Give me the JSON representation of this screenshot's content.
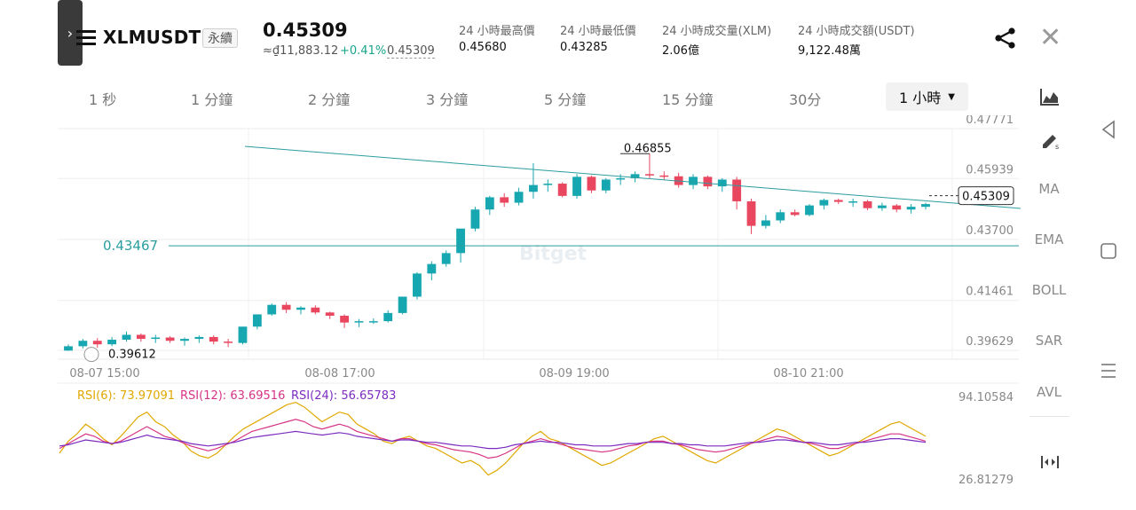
{
  "header": {
    "symbol": "XLMUSDT",
    "contract_type": "永續",
    "last_price": "0.45309",
    "fiat_price": "≈₫11,883.12",
    "change_pct": "+0.41%",
    "mark_price": "0.45309",
    "stats": [
      {
        "label": "24 小時最高價",
        "value": "0.45680"
      },
      {
        "label": "24 小時最低價",
        "value": "0.43285"
      },
      {
        "label": "24 小時成交量(XLM)",
        "value": "2.06億"
      },
      {
        "label": "24 小時成交額(USDT)",
        "value": "9,122.48萬"
      }
    ]
  },
  "timeframes": [
    "1 秒",
    "1 分鐘",
    "2 分鐘",
    "3 分鐘",
    "5 分鐘",
    "15 分鐘",
    "30分"
  ],
  "active_timeframe": "1 小時",
  "tools": [
    "MA",
    "EMA",
    "BOLL",
    "SAR",
    "AVL"
  ],
  "colors": {
    "up": "#17a7b0",
    "down": "#e8475f",
    "accent": "#2a9d9f",
    "rsi6": "#e0a800",
    "rsi12": "#d63384",
    "rsi24": "#7b2cbf"
  },
  "chart_data": [
    {
      "type": "candlestick",
      "price_axis_ticks": [
        "0.47771",
        "0.45939",
        "0.43700",
        "0.41461",
        "0.39629"
      ],
      "time_axis_ticks": [
        "08-07 15:00",
        "08-08 17:00",
        "08-09 19:00",
        "08-10 21:00"
      ],
      "high_label": "0.46855",
      "low_label": "0.39612",
      "horizontal_line_label": "0.43467",
      "current_price_label": "0.45309",
      "watermark": "Bitget",
      "ylim": [
        0.39629,
        0.47771
      ],
      "ohlc": [
        [
          0.3962,
          0.3985,
          0.3961,
          0.3978
        ],
        [
          0.3978,
          0.4005,
          0.397,
          0.3998
        ],
        [
          0.3998,
          0.4008,
          0.3972,
          0.3985
        ],
        [
          0.3985,
          0.4012,
          0.3978,
          0.4002
        ],
        [
          0.4002,
          0.4032,
          0.3995,
          0.402
        ],
        [
          0.402,
          0.4025,
          0.3995,
          0.4005
        ],
        [
          0.4005,
          0.402,
          0.399,
          0.401
        ],
        [
          0.401,
          0.4015,
          0.399,
          0.3998
        ],
        [
          0.3998,
          0.401,
          0.398,
          0.4005
        ],
        [
          0.4005,
          0.4018,
          0.399,
          0.4012
        ],
        [
          0.4012,
          0.4018,
          0.3985,
          0.3995
        ],
        [
          0.3995,
          0.4005,
          0.3975,
          0.399
        ],
        [
          0.399,
          0.404,
          0.3985,
          0.405
        ],
        [
          0.405,
          0.4095,
          0.404,
          0.4095
        ],
        [
          0.4095,
          0.4135,
          0.409,
          0.413
        ],
        [
          0.413,
          0.414,
          0.41,
          0.4112
        ],
        [
          0.4112,
          0.4125,
          0.4095,
          0.412
        ],
        [
          0.412,
          0.4128,
          0.4095,
          0.4102
        ],
        [
          0.4102,
          0.4105,
          0.4078,
          0.409
        ],
        [
          0.409,
          0.4095,
          0.4045,
          0.4065
        ],
        [
          0.4065,
          0.4078,
          0.4048,
          0.407
        ],
        [
          0.407,
          0.408,
          0.406,
          0.407
        ],
        [
          0.407,
          0.411,
          0.4065,
          0.41
        ],
        [
          0.41,
          0.416,
          0.4095,
          0.416
        ],
        [
          0.416,
          0.425,
          0.415,
          0.4245
        ],
        [
          0.4245,
          0.429,
          0.422,
          0.428
        ],
        [
          0.428,
          0.433,
          0.427,
          0.432
        ],
        [
          0.432,
          0.436,
          0.4285,
          0.441
        ],
        [
          0.441,
          0.449,
          0.44,
          0.448
        ],
        [
          0.448,
          0.453,
          0.446,
          0.4525
        ],
        [
          0.4525,
          0.454,
          0.449,
          0.4505
        ],
        [
          0.4505,
          0.456,
          0.4495,
          0.4545
        ],
        [
          0.4545,
          0.465,
          0.452,
          0.457
        ],
        [
          0.457,
          0.459,
          0.4545,
          0.4575
        ],
        [
          0.4575,
          0.458,
          0.4525,
          0.453
        ],
        [
          0.453,
          0.461,
          0.452,
          0.46
        ],
        [
          0.46,
          0.4605,
          0.454,
          0.455
        ],
        [
          0.455,
          0.4595,
          0.454,
          0.459
        ],
        [
          0.459,
          0.461,
          0.457,
          0.4595
        ],
        [
          0.4595,
          0.462,
          0.458,
          0.461
        ],
        [
          0.461,
          0.4685,
          0.4595,
          0.4605
        ],
        [
          0.4605,
          0.462,
          0.459,
          0.4602
        ],
        [
          0.4602,
          0.4615,
          0.456,
          0.457
        ],
        [
          0.457,
          0.461,
          0.4555,
          0.46
        ],
        [
          0.46,
          0.4605,
          0.4555,
          0.4565
        ],
        [
          0.4565,
          0.4595,
          0.4545,
          0.459
        ],
        [
          0.459,
          0.46,
          0.448,
          0.451
        ],
        [
          0.451,
          0.452,
          0.439,
          0.442
        ],
        [
          0.442,
          0.446,
          0.441,
          0.444
        ],
        [
          0.444,
          0.448,
          0.443,
          0.447
        ],
        [
          0.447,
          0.448,
          0.4455,
          0.446
        ],
        [
          0.446,
          0.45,
          0.4455,
          0.4495
        ],
        [
          0.4495,
          0.452,
          0.448,
          0.4515
        ],
        [
          0.4515,
          0.452,
          0.45,
          0.4508
        ],
        [
          0.4508,
          0.452,
          0.449,
          0.451
        ],
        [
          0.451,
          0.4515,
          0.4478,
          0.4485
        ],
        [
          0.4485,
          0.4505,
          0.4475,
          0.4495
        ],
        [
          0.4495,
          0.45,
          0.447,
          0.448
        ],
        [
          0.448,
          0.45,
          0.4465,
          0.449
        ],
        [
          0.449,
          0.4505,
          0.448,
          0.45
        ]
      ]
    },
    {
      "type": "line",
      "series_labels": [
        "RSI(6): 73.97091",
        "RSI(12): 63.69516",
        "RSI(24): 56.65783"
      ],
      "axis_ticks": [
        "94.10584",
        "26.81279"
      ],
      "ylim": [
        26.81279,
        94.10584
      ],
      "series": [
        {
          "name": "RSI(6)",
          "values": [
            48,
            58,
            64,
            72,
            67,
            60,
            55,
            62,
            70,
            78,
            82,
            74,
            70,
            63,
            58,
            50,
            46,
            44,
            48,
            55,
            62,
            68,
            72,
            76,
            80,
            84,
            88,
            90,
            86,
            80,
            74,
            78,
            82,
            80,
            72,
            68,
            64,
            58,
            56,
            60,
            62,
            58,
            54,
            52,
            48,
            44,
            40,
            42,
            38,
            30,
            34,
            40,
            48,
            56,
            62,
            66,
            60,
            58,
            54,
            50,
            46,
            42,
            38,
            40,
            44,
            48,
            52,
            56,
            60,
            62,
            58,
            54,
            50,
            46,
            42,
            40,
            44,
            48,
            52,
            56,
            60,
            64,
            68,
            66,
            62,
            58,
            54,
            50,
            46,
            48,
            52,
            56,
            60,
            64,
            68,
            72,
            74,
            70,
            66,
            62
          ]
        },
        {
          "name": "RSI(12)",
          "values": [
            52,
            56,
            60,
            64,
            62,
            58,
            56,
            58,
            62,
            66,
            70,
            66,
            62,
            60,
            57,
            54,
            52,
            50,
            52,
            55,
            58,
            62,
            66,
            68,
            70,
            72,
            74,
            76,
            74,
            70,
            68,
            70,
            72,
            70,
            66,
            64,
            62,
            60,
            58,
            60,
            60,
            58,
            56,
            55,
            53,
            51,
            50,
            49,
            47,
            44,
            45,
            48,
            52,
            56,
            58,
            60,
            58,
            56,
            54,
            52,
            51,
            50,
            49,
            50,
            52,
            54,
            55,
            57,
            58,
            58,
            56,
            55,
            53,
            51,
            50,
            49,
            50,
            52,
            54,
            56,
            58,
            60,
            62,
            61,
            59,
            57,
            56,
            54,
            52,
            52,
            54,
            56,
            58,
            60,
            62,
            64,
            64,
            62,
            60,
            58
          ]
        },
        {
          "name": "RSI(24)",
          "values": [
            54,
            55,
            57,
            59,
            58,
            57,
            56,
            57,
            59,
            61,
            63,
            61,
            60,
            59,
            58,
            56,
            55,
            54,
            55,
            56,
            57,
            59,
            61,
            62,
            63,
            64,
            65,
            66,
            65,
            64,
            63,
            64,
            65,
            64,
            62,
            61,
            60,
            59,
            58,
            59,
            59,
            58,
            57,
            57,
            56,
            55,
            54,
            54,
            53,
            52,
            52,
            53,
            55,
            56,
            57,
            58,
            57,
            57,
            56,
            55,
            55,
            54,
            54,
            54,
            55,
            56,
            56,
            57,
            57,
            57,
            56,
            56,
            55,
            55,
            54,
            54,
            54,
            55,
            56,
            57,
            57,
            58,
            59,
            59,
            58,
            57,
            57,
            56,
            55,
            55,
            56,
            57,
            57,
            58,
            59,
            60,
            60,
            59,
            58,
            57
          ]
        }
      ]
    }
  ]
}
